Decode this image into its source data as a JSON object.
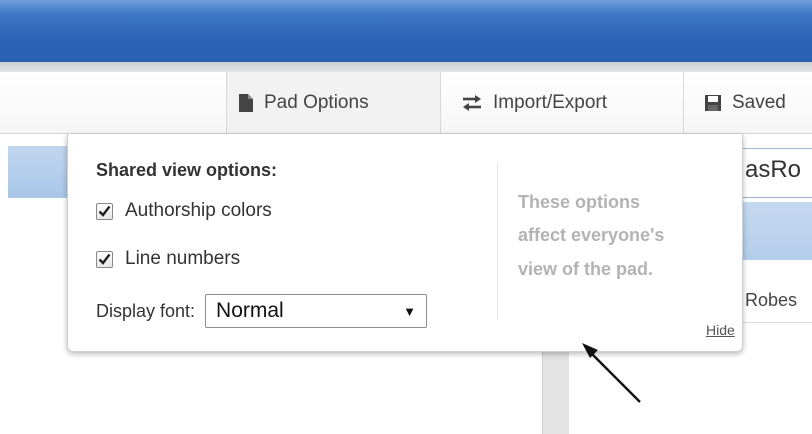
{
  "toolbar": {
    "pad_options_label": "Pad Options",
    "import_export_label": "Import/Export",
    "saved_label": "Saved"
  },
  "background": {
    "right_title": "asRo",
    "right_user": "Robes"
  },
  "popup": {
    "heading": "Shared view options:",
    "authorship_label": "Authorship colors",
    "authorship_checked": true,
    "line_numbers_label": "Line numbers",
    "line_numbers_checked": true,
    "display_font_label": "Display font:",
    "display_font_value": "Normal",
    "note_line1": "These options",
    "note_line2": "affect everyone's",
    "note_line3": "view of the pad.",
    "hide_label": "Hide"
  },
  "colors": {
    "titlebar": "#2c63b4",
    "panel_blue": "#b3cdea",
    "note_gray": "#b3b3b3"
  }
}
